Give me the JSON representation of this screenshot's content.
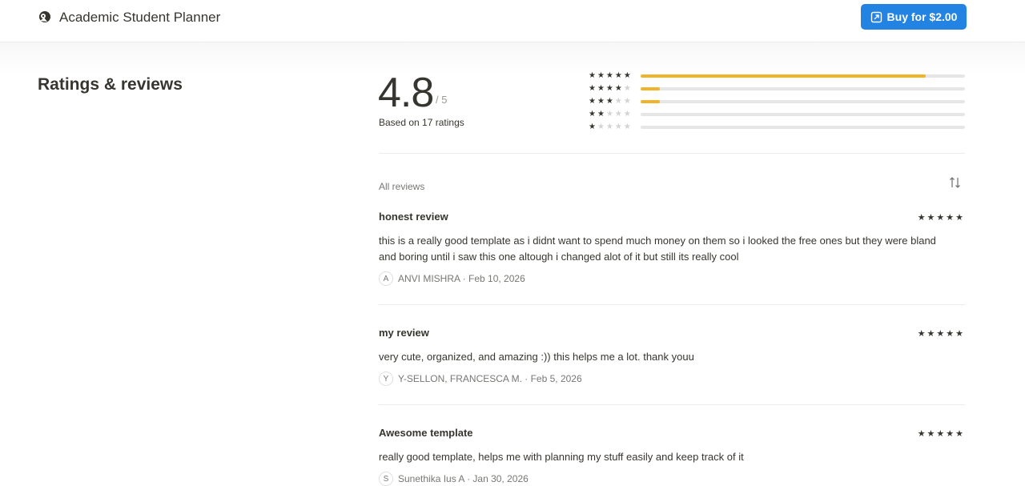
{
  "header": {
    "title": "Academic Student Planner",
    "buy_label": "Buy for $2.00"
  },
  "ratings": {
    "section_title": "Ratings & reviews",
    "score": "4.8",
    "score_max": "/ 5",
    "based_on": "Based on 17 ratings",
    "distribution": [
      {
        "stars": 5,
        "fraction": 0.88
      },
      {
        "stars": 4,
        "fraction": 0.06
      },
      {
        "stars": 3,
        "fraction": 0.06
      },
      {
        "stars": 2,
        "fraction": 0
      },
      {
        "stars": 1,
        "fraction": 0
      }
    ]
  },
  "reviews": {
    "heading": "All reviews",
    "items": [
      {
        "title": "honest review",
        "stars": "★★★★★",
        "body": "this is a really good template as i didnt want to spend much money on them so i looked the free ones but they were bland and boring until i saw this one altough i changed alot of it but still its really cool",
        "avatar": "A",
        "meta": "ANVI MISHRA · Feb 10, 2026"
      },
      {
        "title": "my review",
        "stars": "★★★★★",
        "body": "very cute, organized, and amazing :)) this helps me a lot. thank youu",
        "avatar": "Y",
        "meta": "Y-SELLON, FRANCESCA M. · Feb 5, 2026"
      },
      {
        "title": "Awesome template",
        "stars": "★★★★★",
        "body": "really good template, helps me with planning my stuff easily and keep track of it",
        "avatar": "S",
        "meta": "Sunethika Ius A · Jan 30, 2026"
      }
    ]
  },
  "colors": {
    "accent": "#2383e2",
    "bar_fill": "#f0b429",
    "bar_track": "#e6e6e6"
  }
}
